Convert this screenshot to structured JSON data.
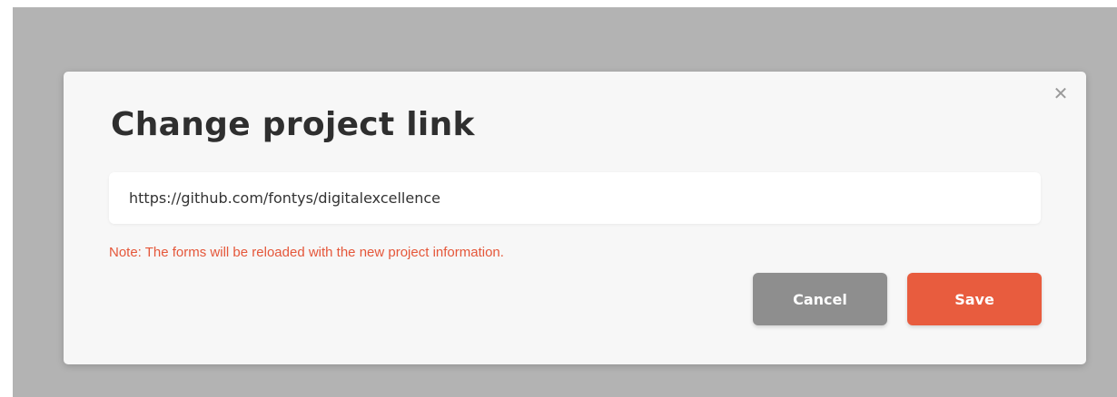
{
  "modal": {
    "title": "Change project link",
    "close_glyph": "✕",
    "link_value": "https://github.com/fontys/digitalexcellence",
    "note": "Note: The forms will be reloaded with the new project information.",
    "cancel_label": "Cancel",
    "save_label": "Save"
  },
  "colors": {
    "overlay": "#b3b3b3",
    "modal_bg": "#f7f7f7",
    "note_text": "#e5573a",
    "cancel_bg": "#8e8e8e",
    "save_bg": "#e85c3e"
  },
  "icons": {
    "close": "close-icon"
  }
}
